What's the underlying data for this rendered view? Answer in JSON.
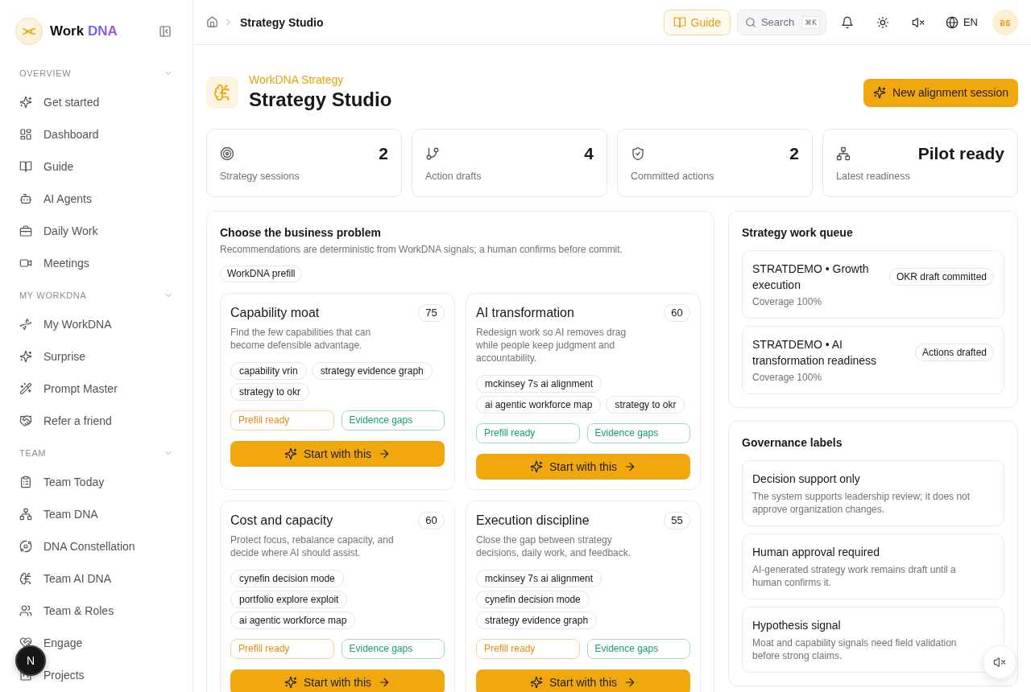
{
  "sidebar": {
    "brand": {
      "name": "Work",
      "accent": "DNA"
    },
    "sections": [
      {
        "title": "OVERVIEW",
        "expanded": true,
        "items": [
          {
            "label": "Get started",
            "selected": false
          },
          {
            "label": "Dashboard",
            "selected": false
          },
          {
            "label": "Guide",
            "selected": false
          },
          {
            "label": "AI Agents",
            "selected": false
          },
          {
            "label": "Daily Work",
            "selected": false
          },
          {
            "label": "Meetings",
            "selected": false
          }
        ]
      },
      {
        "title": "MY WORKDNA",
        "expanded": true,
        "items": [
          {
            "label": "My WorkDNA",
            "selected": false
          },
          {
            "label": "Surprise",
            "selected": false
          },
          {
            "label": "Prompt Master",
            "selected": false
          },
          {
            "label": "Refer a friend",
            "selected": false
          }
        ]
      },
      {
        "title": "TEAM",
        "expanded": true,
        "items": [
          {
            "label": "Team Today",
            "selected": false
          },
          {
            "label": "Team DNA",
            "selected": false
          },
          {
            "label": "DNA Constellation",
            "selected": false
          },
          {
            "label": "Team AI DNA",
            "selected": false
          },
          {
            "label": "Team & Roles",
            "selected": false
          },
          {
            "label": "Engage",
            "selected": false
          },
          {
            "label": "Projects",
            "selected": false
          }
        ]
      }
    ]
  },
  "dev_indicator": {
    "label": "N"
  },
  "header": {
    "breadcrumb": {
      "current": "Strategy Studio"
    },
    "guide_button": "Guide",
    "search": {
      "placeholder": "Search",
      "shortcut": "⌘K"
    },
    "language": "EN",
    "avatar": {
      "initials": "อธ"
    }
  },
  "page_header": {
    "eyebrow": "WorkDNA Strategy",
    "title": "Strategy Studio",
    "action": "New alignment session"
  },
  "stats": [
    {
      "value": "2",
      "label": "Strategy sessions"
    },
    {
      "value": "4",
      "label": "Action drafts"
    },
    {
      "value": "2",
      "label": "Committed actions"
    },
    {
      "value": "Pilot ready",
      "label": "Latest readiness"
    }
  ],
  "problems": {
    "title": "Choose the business problem",
    "description": "Recommendations are deterministic from WorkDNA signals; a human confirms before commit.",
    "chip": "WorkDNA prefill",
    "cards": [
      {
        "title": "Capability moat",
        "score": "75",
        "description": "Find the few capabilities that can become defensible advantage.",
        "tags": [
          "capability vrin",
          "strategy evidence graph",
          "strategy to okr"
        ],
        "badges": [
          {
            "label": "Prefill ready",
            "color": "#ea8a12"
          },
          {
            "label": "Evidence gaps",
            "color": "#14a072"
          }
        ],
        "action": "Start with this"
      },
      {
        "title": "AI transformation",
        "score": "60",
        "description": "Redesign work so AI removes drag while people keep judgment and accountability.",
        "tags": [
          "mckinsey 7s ai alignment",
          "ai agentic workforce map",
          "strategy to okr"
        ],
        "badges": [
          {
            "label": "Prefill ready",
            "color": "#14a072"
          },
          {
            "label": "Evidence gaps",
            "color": "#14a072"
          }
        ],
        "action": "Start with this"
      },
      {
        "title": "Cost and capacity",
        "score": "60",
        "description": "Protect focus, rebalance capacity, and decide where AI should assist.",
        "tags": [
          "cynefin decision mode",
          "portfolio explore exploit",
          "ai agentic workforce map"
        ],
        "badges": [
          {
            "label": "Prefill ready",
            "color": "#ea8a12"
          },
          {
            "label": "Evidence gaps",
            "color": "#14a072"
          }
        ],
        "action": "Start with this"
      },
      {
        "title": "Execution discipline",
        "score": "55",
        "description": "Close the gap between strategy decisions, daily work, and feedback.",
        "tags": [
          "mckinsey 7s ai alignment",
          "cynefin decision mode",
          "strategy evidence graph"
        ],
        "badges": [
          {
            "label": "Prefill ready",
            "color": "#ea8a12"
          },
          {
            "label": "Evidence gaps",
            "color": "#14a072"
          }
        ],
        "action": "Start with this"
      }
    ]
  },
  "queue": {
    "title": "Strategy work queue",
    "items": [
      {
        "title": "STRATDEMO • Growth execution",
        "status": "OKR draft committed",
        "coverage": "Coverage 100%"
      },
      {
        "title": "STRATDEMO • AI transformation readiness",
        "status": "Actions drafted",
        "coverage": "Coverage 100%"
      }
    ]
  },
  "governance": {
    "title": "Governance labels",
    "items": [
      {
        "title": "Decision support only",
        "description": "The system supports leadership review; it does not approve organization changes."
      },
      {
        "title": "Human approval required",
        "description": "AI-generated strategy work remains draft until a human confirms it."
      },
      {
        "title": "Hypothesis signal",
        "description": "Moat and capability signals need field validation before strong claims."
      }
    ]
  }
}
